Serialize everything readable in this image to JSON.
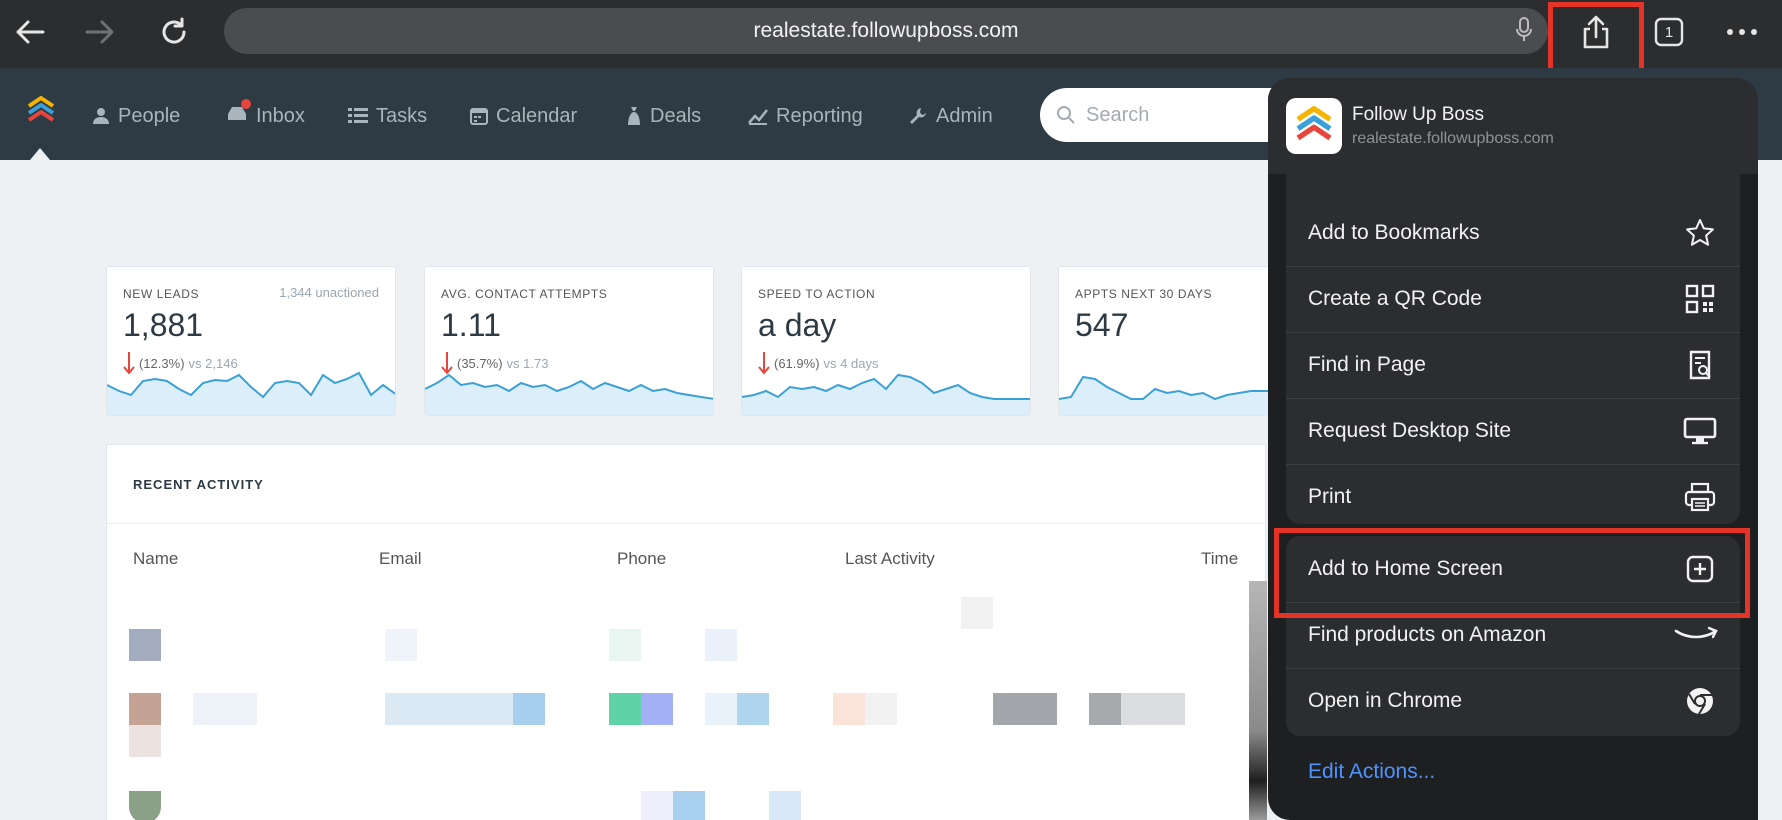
{
  "browser": {
    "url": "realestate.followupboss.com",
    "tab_count": "1",
    "icons": [
      "back-arrow-icon",
      "forward-arrow-icon",
      "reload-icon",
      "microphone-icon",
      "share-icon",
      "tabs-icon",
      "more-icon"
    ]
  },
  "nav": {
    "items": [
      {
        "label": "People",
        "icon": "person-icon"
      },
      {
        "label": "Inbox",
        "icon": "inbox-icon"
      },
      {
        "label": "Tasks",
        "icon": "tasks-icon"
      },
      {
        "label": "Calendar",
        "icon": "calendar-icon"
      },
      {
        "label": "Deals",
        "icon": "deals-icon"
      },
      {
        "label": "Reporting",
        "icon": "reporting-icon"
      },
      {
        "label": "Admin",
        "icon": "wrench-icon"
      }
    ],
    "search_placeholder": "Search"
  },
  "stats": [
    {
      "label": "NEW LEADS",
      "extra": "1,344 unactioned",
      "value": "1,881",
      "delta": "(12.3%)",
      "vs": "vs 2,146",
      "trend": "down"
    },
    {
      "label": "AVG. CONTACT ATTEMPTS",
      "extra": "",
      "value": "1.11",
      "delta": "(35.7%)",
      "vs": "vs 1.73",
      "trend": "down"
    },
    {
      "label": "SPEED TO ACTION",
      "extra": "",
      "value": "a day",
      "delta": "(61.9%)",
      "vs": "vs 4 days",
      "trend": "down"
    },
    {
      "label": "APPTS NEXT 30 DAYS",
      "extra": "",
      "value": "547",
      "delta": "",
      "vs": "",
      "trend": ""
    }
  ],
  "activity": {
    "title": "RECENT ACTIVITY",
    "columns": [
      "Name",
      "Email",
      "Phone",
      "Last Activity",
      "Time"
    ]
  },
  "share_sheet": {
    "app_title": "Follow Up Boss",
    "app_subtitle": "realestate.followupboss.com",
    "actions_group1": [
      {
        "label": "Add to Bookmarks",
        "icon": "star-icon"
      },
      {
        "label": "Create a QR Code",
        "icon": "qr-code-icon"
      },
      {
        "label": "Find in Page",
        "icon": "find-in-page-icon"
      },
      {
        "label": "Request Desktop Site",
        "icon": "desktop-icon"
      },
      {
        "label": "Print",
        "icon": "printer-icon"
      }
    ],
    "actions_group2": [
      {
        "label": "Add to Home Screen",
        "icon": "add-square-icon"
      },
      {
        "label": "Find products on Amazon",
        "icon": "amazon-icon"
      },
      {
        "label": "Open in Chrome",
        "icon": "chrome-icon"
      }
    ],
    "edit_actions": "Edit Actions..."
  },
  "colors": {
    "highlight": "#e53327",
    "navbar": "#2e3b44",
    "sparkline": "#3aa0d8",
    "link": "#4f93ff"
  }
}
